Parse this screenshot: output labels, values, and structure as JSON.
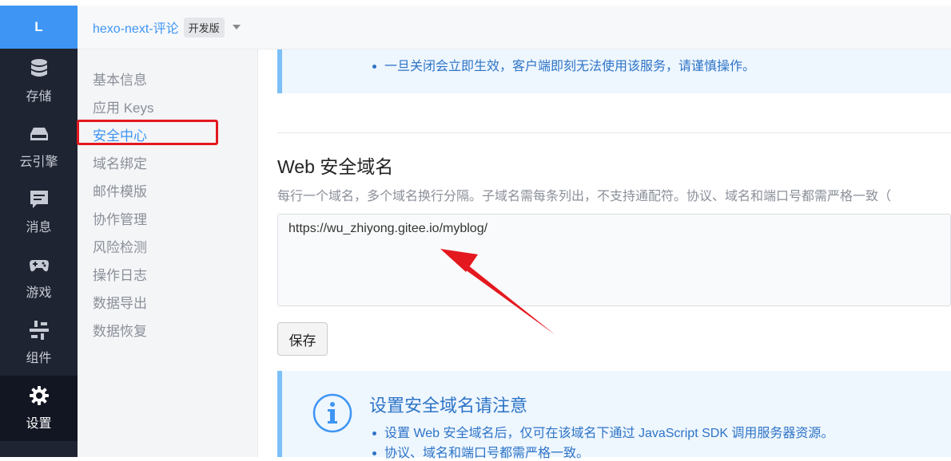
{
  "nav": {
    "logo": "L",
    "items": [
      {
        "label": "存储",
        "icon": "database-icon"
      },
      {
        "label": "云引擎",
        "icon": "server-icon"
      },
      {
        "label": "消息",
        "icon": "message-icon"
      },
      {
        "label": "游戏",
        "icon": "gamepad-icon"
      },
      {
        "label": "组件",
        "icon": "components-icon"
      },
      {
        "label": "设置",
        "icon": "gear-icon"
      }
    ]
  },
  "header": {
    "app_name": "hexo-next-评论",
    "badge": "开发版"
  },
  "sidebar": {
    "items": [
      "基本信息",
      "应用 Keys",
      "安全中心",
      "域名绑定",
      "邮件模版",
      "协作管理",
      "风险检测",
      "操作日志",
      "数据导出",
      "数据恢复"
    ],
    "active": "安全中心"
  },
  "notice1": {
    "item": "一旦关闭会立即生效，客户端即刻无法使用该服务，请谨慎操作。"
  },
  "web_domain": {
    "title": "Web 安全域名",
    "description": "每行一个域名，多个域名换行分隔。子域名需每条列出，不支持通配符。协议、域名和端口号都需严格一致（",
    "value": "https://wu_zhiyong.gitee.io/myblog/",
    "save_label": "保存"
  },
  "notice2": {
    "title": "设置安全域名请注意",
    "items": [
      "设置 Web 安全域名后，仅可在该域名下通过 JavaScript SDK 调用服务器资源。",
      "协议、域名和端口号都需严格一致。"
    ]
  },
  "colors": {
    "accent": "#3e95f4",
    "nav_bg": "#1f2432",
    "highlight_box": "#e4181f"
  }
}
